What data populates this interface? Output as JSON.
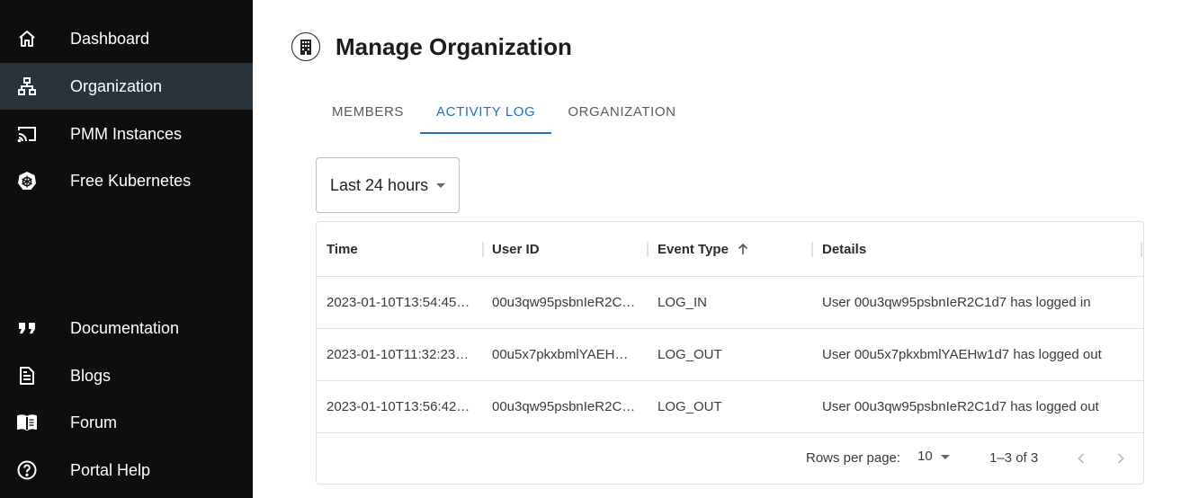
{
  "sidebar": {
    "items": [
      {
        "label": "Dashboard",
        "icon": "home-icon"
      },
      {
        "label": "Organization",
        "icon": "org-chart-icon"
      },
      {
        "label": "PMM Instances",
        "icon": "cast-icon"
      },
      {
        "label": "Free Kubernetes",
        "icon": "kubernetes-icon"
      },
      {
        "label": "Documentation",
        "icon": "quote-icon"
      },
      {
        "label": "Blogs",
        "icon": "article-icon"
      },
      {
        "label": "Forum",
        "icon": "book-open-icon"
      },
      {
        "label": "Portal Help",
        "icon": "help-circle-icon"
      }
    ],
    "active": "Organization"
  },
  "page": {
    "title": "Manage Organization",
    "title_icon": "building-icon"
  },
  "tabs": [
    {
      "label": "MEMBERS"
    },
    {
      "label": "ACTIVITY LOG"
    },
    {
      "label": "ORGANIZATION"
    }
  ],
  "active_tab": "ACTIVITY LOG",
  "filter": {
    "selected": "Last 24 hours"
  },
  "table": {
    "columns": [
      "Time",
      "User ID",
      "Event Type",
      "Details"
    ],
    "sorted_column": "Event Type",
    "sort_direction": "ascending",
    "rows": [
      {
        "time": "2023-01-10T13:54:45…",
        "user_id": "00u3qw95psbnIeR2C…",
        "event_type": "LOG_IN",
        "details": "User 00u3qw95psbnIeR2C1d7 has logged in"
      },
      {
        "time": "2023-01-10T11:32:23…",
        "user_id": "00u5x7pkxbmlYAEH…",
        "event_type": "LOG_OUT",
        "details": "User 00u5x7pkxbmlYAEHw1d7 has logged out"
      },
      {
        "time": "2023-01-10T13:56:42…",
        "user_id": "00u3qw95psbnIeR2C…",
        "event_type": "LOG_OUT",
        "details": "User 00u3qw95psbnIeR2C1d7 has logged out"
      }
    ]
  },
  "pagination": {
    "rows_per_page_label": "Rows per page:",
    "rows_per_page": "10",
    "range": "1–3 of 3"
  },
  "colors": {
    "sidebar_bg": "#0e0e0e",
    "sidebar_active": "#2a323a",
    "accent": "#1e6fc0"
  }
}
